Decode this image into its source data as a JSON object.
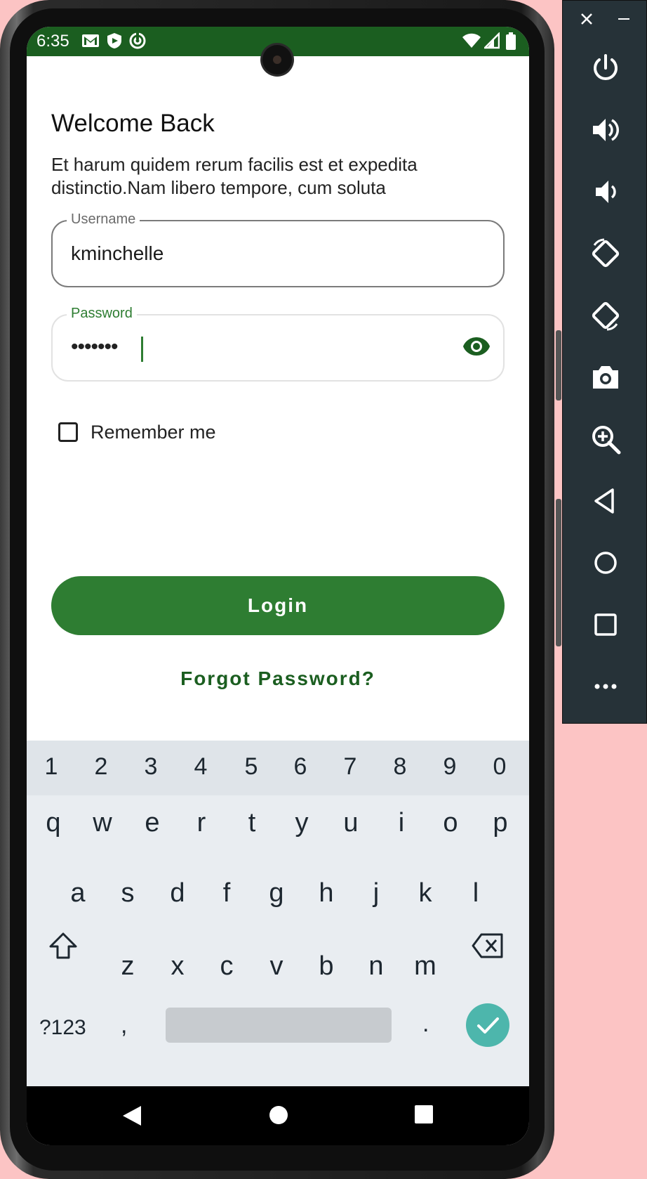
{
  "status_bar": {
    "time": "6:35"
  },
  "login": {
    "title": "Welcome Back",
    "subtitle": "Et harum quidem rerum facilis est et expedita distinctio.Nam libero tempore, cum soluta",
    "username": {
      "label": "Username",
      "value": "kminchelle"
    },
    "password": {
      "label": "Password",
      "value": "•••••••"
    },
    "remember_label": "Remember me",
    "login_label": "Login",
    "forgot_label": "Forgot Password?"
  },
  "keyboard": {
    "numbers": [
      "1",
      "2",
      "3",
      "4",
      "5",
      "6",
      "7",
      "8",
      "9",
      "0"
    ],
    "row1": [
      "q",
      "w",
      "e",
      "r",
      "t",
      "y",
      "u",
      "i",
      "o",
      "p"
    ],
    "row2": [
      "a",
      "s",
      "d",
      "f",
      "g",
      "h",
      "j",
      "k",
      "l"
    ],
    "row3": [
      "z",
      "x",
      "c",
      "v",
      "b",
      "n",
      "m"
    ],
    "symbols": "?123",
    "comma": ",",
    "period": "."
  },
  "colors": {
    "primary": "#2e7d32",
    "status_bar": "#1b5e20",
    "panel": "#263238",
    "enter": "#4db6ac"
  }
}
